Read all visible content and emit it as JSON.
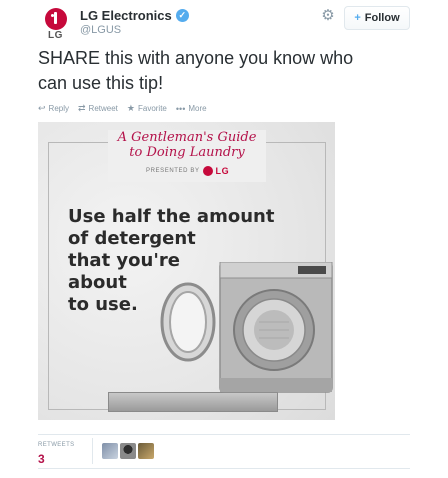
{
  "account": {
    "display_name": "LG Electronics",
    "handle": "@LGUS",
    "avatar_logo_text": "LG",
    "verified_glyph": "✓"
  },
  "header": {
    "follow_label": "Follow",
    "follow_icon": "+"
  },
  "tweet": {
    "text_line1": "SHARE this with anyone you know who",
    "text_line2": "can use this tip!"
  },
  "actions": [
    {
      "icon": "reply-icon",
      "glyph": "↩",
      "label": "Reply"
    },
    {
      "icon": "retweet-icon",
      "glyph": "⇄",
      "label": "Retweet"
    },
    {
      "icon": "favorite-icon",
      "glyph": "★",
      "label": "Favorite"
    },
    {
      "icon": "more-icon",
      "glyph": "•••",
      "label": "More"
    }
  ],
  "media": {
    "title_line1": "A Gentleman's Guide",
    "title_line2": "to Doing Laundry",
    "presented_by": "PRESENTED BY",
    "presented_logo": "LG",
    "headline": [
      "Use half the amount",
      "of detergent",
      "that you're",
      "about",
      "to use."
    ]
  },
  "stats": {
    "retweets_label": "RETWEETS",
    "retweets_count": "3"
  },
  "colors": {
    "brand_red": "#c6093b",
    "twitter_blue": "#55acee",
    "muted_gray": "#8899a6"
  }
}
